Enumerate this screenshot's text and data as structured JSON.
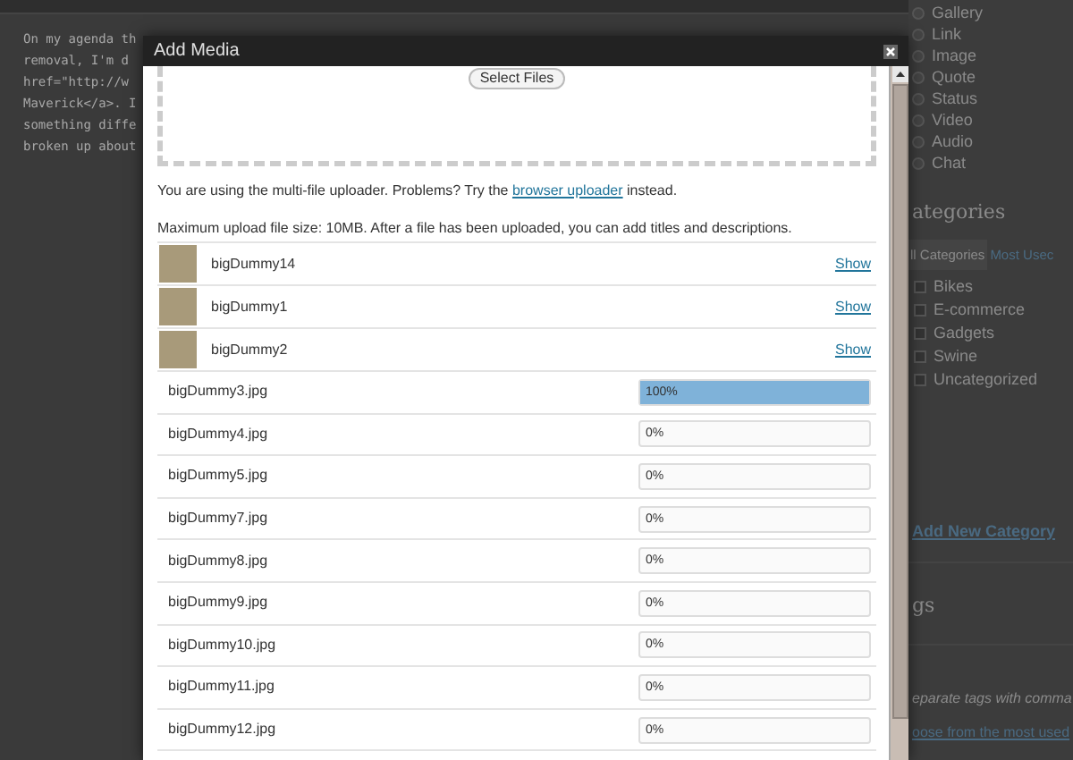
{
  "editor": {
    "lines": [
      "On my agenda th",
      "removal, I'm d",
      "href=\"http://w",
      "Maverick</a>. I",
      "something diffe",
      "broken up about"
    ]
  },
  "sidebar": {
    "formats": [
      {
        "label": "Gallery",
        "selected": false
      },
      {
        "label": "Link",
        "selected": false
      },
      {
        "label": "Image",
        "selected": false
      },
      {
        "label": "Quote",
        "selected": false
      },
      {
        "label": "Status",
        "selected": false
      },
      {
        "label": "Video",
        "selected": false
      },
      {
        "label": "Audio",
        "selected": false
      },
      {
        "label": "Chat",
        "selected": false
      }
    ],
    "categories": {
      "title": "ategories",
      "tabs": [
        {
          "label": "ll Categories",
          "selected": true
        },
        {
          "label": "Most Usec",
          "selected": false
        }
      ],
      "items": [
        {
          "label": "Bikes",
          "checked": false
        },
        {
          "label": "E-commerce",
          "checked": false
        },
        {
          "label": "Gadgets",
          "checked": false
        },
        {
          "label": "Swine",
          "checked": false
        },
        {
          "label": "Uncategorized",
          "checked": false
        }
      ],
      "add_link": "Add New Category"
    },
    "tags": {
      "title": "gs",
      "hint": "eparate tags with comma",
      "link": "oose from the most used"
    }
  },
  "dialog": {
    "title": "Add Media",
    "select_button": "Select Files",
    "notice": {
      "before": "You are using the multi-file uploader. Problems? Try the ",
      "link": "browser uploader",
      "after": " instead."
    },
    "max_size": "Maximum upload file size: 10MB. After a file has been uploaded, you can add titles and descriptions.",
    "files": [
      {
        "kind": "done",
        "name": "bigDummy14",
        "action": "Show"
      },
      {
        "kind": "done",
        "name": "bigDummy1",
        "action": "Show"
      },
      {
        "kind": "done",
        "name": "bigDummy2",
        "action": "Show"
      },
      {
        "kind": "progress",
        "name": "bigDummy3.jpg",
        "level": 1,
        "reading": "100%"
      },
      {
        "kind": "progress",
        "name": "bigDummy4.jpg",
        "level": 0,
        "reading": "0%"
      },
      {
        "kind": "progress",
        "name": "bigDummy5.jpg",
        "level": 0,
        "reading": "0%"
      },
      {
        "kind": "progress",
        "name": "bigDummy7.jpg",
        "level": 0,
        "reading": "0%"
      },
      {
        "kind": "progress",
        "name": "bigDummy8.jpg",
        "level": 0,
        "reading": "0%"
      },
      {
        "kind": "progress",
        "name": "bigDummy9.jpg",
        "level": 0,
        "reading": "0%"
      },
      {
        "kind": "progress",
        "name": "bigDummy10.jpg",
        "level": 0,
        "reading": "0%"
      },
      {
        "kind": "progress",
        "name": "bigDummy11.jpg",
        "level": 0,
        "reading": "0%"
      },
      {
        "kind": "progress",
        "name": "bigDummy12.jpg",
        "level": 0,
        "reading": "0%"
      }
    ]
  }
}
